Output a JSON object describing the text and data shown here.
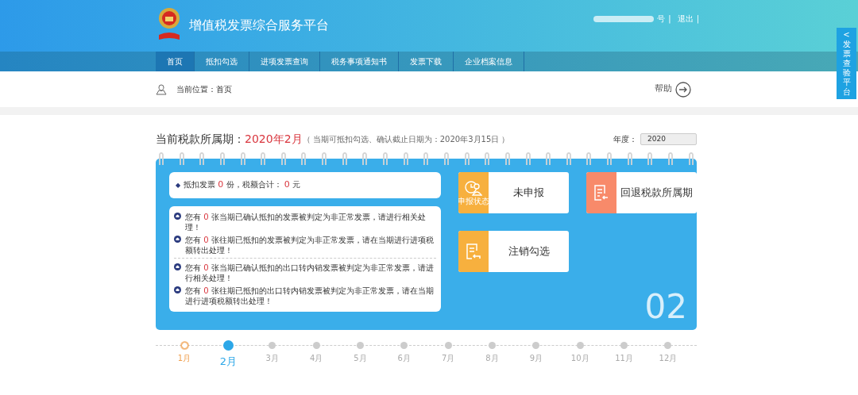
{
  "header": {
    "title": "增值税发票综合服务平台",
    "user_suffix": "号",
    "separator": "|",
    "logout": "退出"
  },
  "side_tab": {
    "arrow": "<",
    "label": "发票查验平台"
  },
  "nav": [
    {
      "label": "首页",
      "selected": true
    },
    {
      "label": "抵扣勾选",
      "selected": false
    },
    {
      "label": "进项发票查询",
      "selected": false
    },
    {
      "label": "税务事项通知书",
      "selected": false
    },
    {
      "label": "发票下载",
      "selected": false
    },
    {
      "label": "企业档案信息",
      "selected": false
    }
  ],
  "breadcrumb": "当前位置：首页",
  "help": "帮助",
  "period": {
    "label": "当前税款所属期：",
    "value": "2020年2月",
    "note": "（ 当期可抵扣勾选、确认截止日期为：2020年3月15日 ）",
    "year_label": "年度：",
    "year_value": "2020"
  },
  "summary": {
    "bullet": "◆",
    "prefix": "抵扣发票",
    "count": "0",
    "mid": "份，税额合计：",
    "amount": "0",
    "suffix": "元"
  },
  "notices": [
    {
      "prefix": "您有",
      "count": "0",
      "text": "张当期已确认抵扣的发票被判定为非正常发票，请进行相关处理！"
    },
    {
      "prefix": "您有",
      "count": "0",
      "text": "张往期已抵扣的发票被判定为非正常发票，请在当期进行进项税额转出处理！"
    },
    {
      "prefix": "您有",
      "count": "0",
      "text": "张当期已确认抵扣的出口转内销发票被判定为非正常发票，请进行相关处理！"
    },
    {
      "prefix": "您有",
      "count": "0",
      "text": "张往期已抵扣的出口转内销发票被判定为非正常发票，请在当期进行进项税额转出处理！"
    }
  ],
  "tiles": [
    {
      "kind": "status",
      "icon_label": "申报状态",
      "label": "未申报",
      "color": "#f7b03e"
    },
    {
      "kind": "return",
      "label": "回退税款所属期",
      "color": "#f88a6a"
    },
    {
      "kind": "cancel",
      "label": "注销勾选",
      "color": "#f7b03e"
    }
  ],
  "month_number": "02",
  "months": [
    {
      "label": "1月",
      "selected": false,
      "done": true
    },
    {
      "label": "2月",
      "selected": true,
      "done": false
    },
    {
      "label": "3月",
      "selected": false,
      "done": false
    },
    {
      "label": "4月",
      "selected": false,
      "done": false
    },
    {
      "label": "5月",
      "selected": false,
      "done": false
    },
    {
      "label": "6月",
      "selected": false,
      "done": false
    },
    {
      "label": "7月",
      "selected": false,
      "done": false
    },
    {
      "label": "8月",
      "selected": false,
      "done": false
    },
    {
      "label": "9月",
      "selected": false,
      "done": false
    },
    {
      "label": "10月",
      "selected": false,
      "done": false
    },
    {
      "label": "11月",
      "selected": false,
      "done": false
    },
    {
      "label": "12月",
      "selected": false,
      "done": false
    }
  ]
}
